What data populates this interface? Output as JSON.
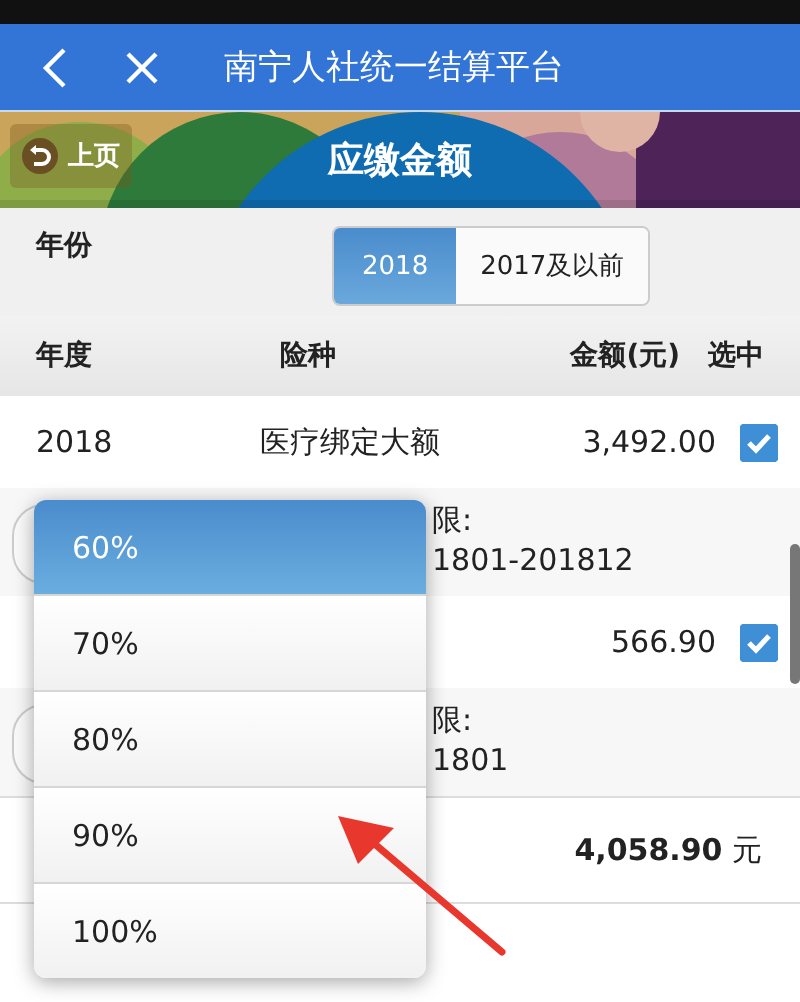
{
  "header": {
    "title": "南宁人社统一结算平台"
  },
  "banner": {
    "back_label": "上页",
    "title": "应缴金额"
  },
  "year_filter": {
    "label": "年份",
    "options": [
      {
        "label": "2018",
        "selected": true
      },
      {
        "label": "2017及以前",
        "selected": false
      }
    ]
  },
  "table": {
    "columns": [
      "年度",
      "险种",
      "金额(元)",
      "选中"
    ],
    "rows": [
      {
        "year": "2018",
        "type": "医疗绑定大额",
        "amount": "3,492.00",
        "checked": true,
        "period_label": "限:",
        "period": "1801-201812"
      },
      {
        "amount": "566.90",
        "checked": true,
        "period_label": "限:",
        "period": "1801"
      }
    ]
  },
  "total": {
    "amount": "4,058.90",
    "unit": "元"
  },
  "dropdown": {
    "options": [
      {
        "label": "60%",
        "selected": true
      },
      {
        "label": "70%",
        "selected": false
      },
      {
        "label": "80%",
        "selected": false
      },
      {
        "label": "90%",
        "selected": false
      },
      {
        "label": "100%",
        "selected": false
      }
    ]
  }
}
